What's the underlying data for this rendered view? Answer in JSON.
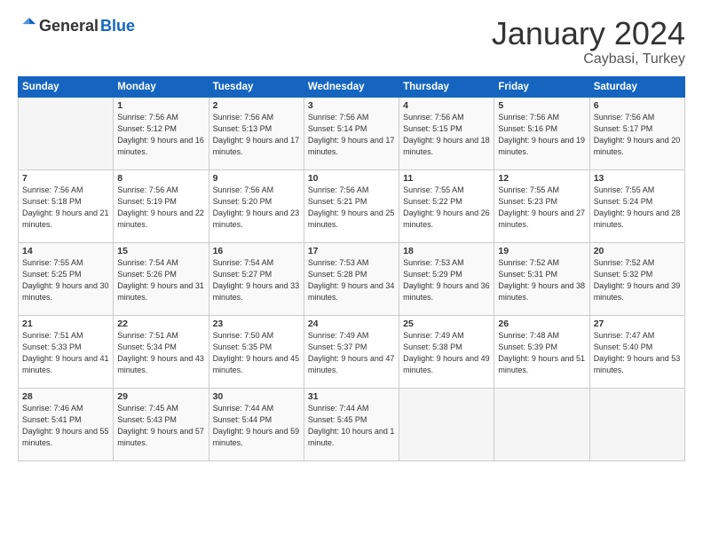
{
  "logo": {
    "general": "General",
    "blue": "Blue"
  },
  "header": {
    "month": "January 2024",
    "location": "Caybasi, Turkey"
  },
  "weekdays": [
    "Sunday",
    "Monday",
    "Tuesday",
    "Wednesday",
    "Thursday",
    "Friday",
    "Saturday"
  ],
  "weeks": [
    [
      {
        "day": null,
        "sunrise": null,
        "sunset": null,
        "daylight": null
      },
      {
        "day": "1",
        "sunrise": "Sunrise: 7:56 AM",
        "sunset": "Sunset: 5:12 PM",
        "daylight": "Daylight: 9 hours and 16 minutes."
      },
      {
        "day": "2",
        "sunrise": "Sunrise: 7:56 AM",
        "sunset": "Sunset: 5:13 PM",
        "daylight": "Daylight: 9 hours and 17 minutes."
      },
      {
        "day": "3",
        "sunrise": "Sunrise: 7:56 AM",
        "sunset": "Sunset: 5:14 PM",
        "daylight": "Daylight: 9 hours and 17 minutes."
      },
      {
        "day": "4",
        "sunrise": "Sunrise: 7:56 AM",
        "sunset": "Sunset: 5:15 PM",
        "daylight": "Daylight: 9 hours and 18 minutes."
      },
      {
        "day": "5",
        "sunrise": "Sunrise: 7:56 AM",
        "sunset": "Sunset: 5:16 PM",
        "daylight": "Daylight: 9 hours and 19 minutes."
      },
      {
        "day": "6",
        "sunrise": "Sunrise: 7:56 AM",
        "sunset": "Sunset: 5:17 PM",
        "daylight": "Daylight: 9 hours and 20 minutes."
      }
    ],
    [
      {
        "day": "7",
        "sunrise": "Sunrise: 7:56 AM",
        "sunset": "Sunset: 5:18 PM",
        "daylight": "Daylight: 9 hours and 21 minutes."
      },
      {
        "day": "8",
        "sunrise": "Sunrise: 7:56 AM",
        "sunset": "Sunset: 5:19 PM",
        "daylight": "Daylight: 9 hours and 22 minutes."
      },
      {
        "day": "9",
        "sunrise": "Sunrise: 7:56 AM",
        "sunset": "Sunset: 5:20 PM",
        "daylight": "Daylight: 9 hours and 23 minutes."
      },
      {
        "day": "10",
        "sunrise": "Sunrise: 7:56 AM",
        "sunset": "Sunset: 5:21 PM",
        "daylight": "Daylight: 9 hours and 25 minutes."
      },
      {
        "day": "11",
        "sunrise": "Sunrise: 7:55 AM",
        "sunset": "Sunset: 5:22 PM",
        "daylight": "Daylight: 9 hours and 26 minutes."
      },
      {
        "day": "12",
        "sunrise": "Sunrise: 7:55 AM",
        "sunset": "Sunset: 5:23 PM",
        "daylight": "Daylight: 9 hours and 27 minutes."
      },
      {
        "day": "13",
        "sunrise": "Sunrise: 7:55 AM",
        "sunset": "Sunset: 5:24 PM",
        "daylight": "Daylight: 9 hours and 28 minutes."
      }
    ],
    [
      {
        "day": "14",
        "sunrise": "Sunrise: 7:55 AM",
        "sunset": "Sunset: 5:25 PM",
        "daylight": "Daylight: 9 hours and 30 minutes."
      },
      {
        "day": "15",
        "sunrise": "Sunrise: 7:54 AM",
        "sunset": "Sunset: 5:26 PM",
        "daylight": "Daylight: 9 hours and 31 minutes."
      },
      {
        "day": "16",
        "sunrise": "Sunrise: 7:54 AM",
        "sunset": "Sunset: 5:27 PM",
        "daylight": "Daylight: 9 hours and 33 minutes."
      },
      {
        "day": "17",
        "sunrise": "Sunrise: 7:53 AM",
        "sunset": "Sunset: 5:28 PM",
        "daylight": "Daylight: 9 hours and 34 minutes."
      },
      {
        "day": "18",
        "sunrise": "Sunrise: 7:53 AM",
        "sunset": "Sunset: 5:29 PM",
        "daylight": "Daylight: 9 hours and 36 minutes."
      },
      {
        "day": "19",
        "sunrise": "Sunrise: 7:52 AM",
        "sunset": "Sunset: 5:31 PM",
        "daylight": "Daylight: 9 hours and 38 minutes."
      },
      {
        "day": "20",
        "sunrise": "Sunrise: 7:52 AM",
        "sunset": "Sunset: 5:32 PM",
        "daylight": "Daylight: 9 hours and 39 minutes."
      }
    ],
    [
      {
        "day": "21",
        "sunrise": "Sunrise: 7:51 AM",
        "sunset": "Sunset: 5:33 PM",
        "daylight": "Daylight: 9 hours and 41 minutes."
      },
      {
        "day": "22",
        "sunrise": "Sunrise: 7:51 AM",
        "sunset": "Sunset: 5:34 PM",
        "daylight": "Daylight: 9 hours and 43 minutes."
      },
      {
        "day": "23",
        "sunrise": "Sunrise: 7:50 AM",
        "sunset": "Sunset: 5:35 PM",
        "daylight": "Daylight: 9 hours and 45 minutes."
      },
      {
        "day": "24",
        "sunrise": "Sunrise: 7:49 AM",
        "sunset": "Sunset: 5:37 PM",
        "daylight": "Daylight: 9 hours and 47 minutes."
      },
      {
        "day": "25",
        "sunrise": "Sunrise: 7:49 AM",
        "sunset": "Sunset: 5:38 PM",
        "daylight": "Daylight: 9 hours and 49 minutes."
      },
      {
        "day": "26",
        "sunrise": "Sunrise: 7:48 AM",
        "sunset": "Sunset: 5:39 PM",
        "daylight": "Daylight: 9 hours and 51 minutes."
      },
      {
        "day": "27",
        "sunrise": "Sunrise: 7:47 AM",
        "sunset": "Sunset: 5:40 PM",
        "daylight": "Daylight: 9 hours and 53 minutes."
      }
    ],
    [
      {
        "day": "28",
        "sunrise": "Sunrise: 7:46 AM",
        "sunset": "Sunset: 5:41 PM",
        "daylight": "Daylight: 9 hours and 55 minutes."
      },
      {
        "day": "29",
        "sunrise": "Sunrise: 7:45 AM",
        "sunset": "Sunset: 5:43 PM",
        "daylight": "Daylight: 9 hours and 57 minutes."
      },
      {
        "day": "30",
        "sunrise": "Sunrise: 7:44 AM",
        "sunset": "Sunset: 5:44 PM",
        "daylight": "Daylight: 9 hours and 59 minutes."
      },
      {
        "day": "31",
        "sunrise": "Sunrise: 7:44 AM",
        "sunset": "Sunset: 5:45 PM",
        "daylight": "Daylight: 10 hours and 1 minute."
      },
      {
        "day": null,
        "sunrise": null,
        "sunset": null,
        "daylight": null
      },
      {
        "day": null,
        "sunrise": null,
        "sunset": null,
        "daylight": null
      },
      {
        "day": null,
        "sunrise": null,
        "sunset": null,
        "daylight": null
      }
    ]
  ]
}
